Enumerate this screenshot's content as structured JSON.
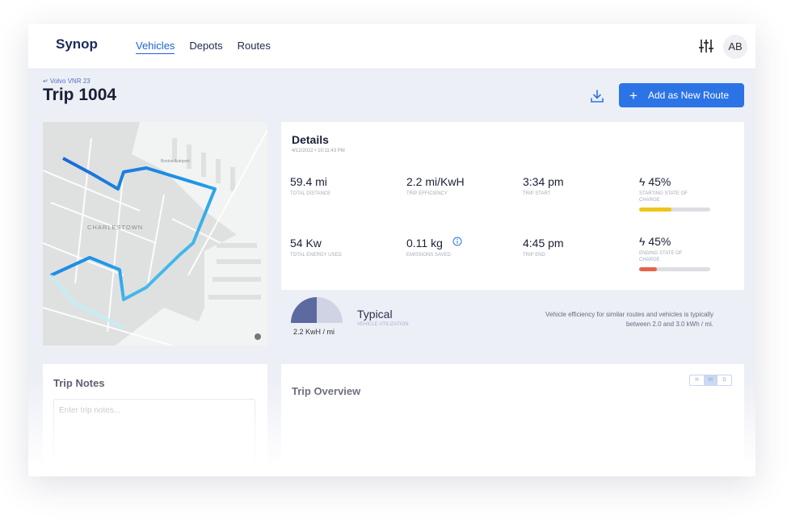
{
  "brand": {
    "name": "Synop"
  },
  "nav": {
    "items": [
      {
        "label": "Vehicles",
        "active": true
      },
      {
        "label": "Depots"
      },
      {
        "label": "Routes"
      }
    ]
  },
  "header": {
    "avatar": "AB",
    "icons": [
      "sliders-icon"
    ]
  },
  "page": {
    "back_link": "↵ Volvo VNR 23",
    "title": "Trip 1004",
    "add_route_label": "Add as New Route"
  },
  "map": {
    "labels": [
      "CHARLESTOWN",
      "Boston Autoport"
    ]
  },
  "details": {
    "title": "Details",
    "date": "4/12/2022 • 10:11:43 PM",
    "stats": [
      {
        "value": "59.4 mi",
        "label": "TOTAL DISTANCE"
      },
      {
        "value": "2.2 mi/KwH",
        "label": "TRIP EFFICIENCY"
      },
      {
        "value": "3:34 pm",
        "label": "TRIP START"
      },
      {
        "value": "45%",
        "label": "STARTING STATE OF CHARGE",
        "level": 0.45,
        "color": "#f0c419"
      },
      {
        "value": "54 Kw",
        "label": "TOTAL ENERGY USED"
      },
      {
        "value": "0.11 kg",
        "label": "EMISSIONS SAVED"
      },
      {
        "value": "4:45 pm",
        "label": "TRIP END"
      },
      {
        "value": "45%",
        "label": "ENDING STATE OF CHARGE",
        "level": 0.25,
        "color": "#e5654a"
      }
    ]
  },
  "typical": {
    "label": "Typical",
    "sub": "VEHICLE UTILIZATION",
    "unit": "2.2 KwH / mi",
    "note": "Vehicle efficiency for similar routes and vehicles is typically between 2.0 and 3.0 kWh / mi."
  },
  "notes": {
    "title": "Trip Notes",
    "placeholder": "Enter trip notes..."
  },
  "overview": {
    "title": "Trip Overview",
    "pager": [
      "H",
      "M",
      "D"
    ]
  },
  "colors": {
    "accent": "#2c74e6",
    "route_dark": "#1b63d6",
    "route_light": "#5fd0ea"
  }
}
